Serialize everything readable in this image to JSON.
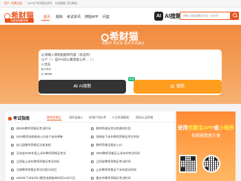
{
  "topbar": {
    "login": "用户 / 免费注册",
    "notice": "2023년 考试报名资讯",
    "link1": "在线客服",
    "link2": "官方微信"
  },
  "header": {
    "logo_text": "希财猫",
    "logo_sub": "优题宝刷题神器",
    "nav": [
      "首页",
      "题库",
      "考试资讯",
      "搜题APP",
      "问鉴"
    ],
    "ai_label": "AI搜题",
    "search_placeholder": "请输入或粘贴题目内容（含选项）"
  },
  "hero": {
    "brand": "希财猫",
    "slogan": "找题目 找答案  助考考试通过",
    "question_lines": [
      "Q:请输入或粘贴题目内容（含选项）",
      "以下（  ）是IPO前公募基金公开...（ ）",
      "A.优先",
      "B.CPU",
      "C.ROM"
    ],
    "ai_button": "AI搜题",
    "new_tag": "NEW",
    "search_button": "搜题"
  },
  "panel": {
    "title": "考试指南",
    "tabs": [
      "教师资格证",
      "消防设施人",
      "房地产估价师",
      "人力资源管理",
      "保险从业资格"
    ],
    "left_items": [
      "湖州市教师资格证考试时间",
      "2025教资成绩查询入口各个省市更新",
      "幼儿园教师资格证注册流程",
      "河北省2025年度上半年教师资格证考试",
      "江西省上半年教师资格证考试时间",
      "河南教师资格证考试内容与科目",
      "2025年下半年四川教资成绩查询时间(11月7日)"
    ],
    "right_items": [
      "教师资格证考试的规则作用",
      "湖南省下半年教师资格证考试时间",
      "教师资格证报名入口",
      "2025教师资格证上半年的考试时间",
      "江西省教师资格证考试时间",
      "山东教师资格证下半年面试时间",
      "重庆市教师资格证考试时间"
    ]
  },
  "promo": {
    "title_prefix": "使用",
    "title_highlight": "优题宝APP",
    "title_mid": "或",
    "title_highlight2": "小程序",
    "subtitle": "拍照搜题更方便"
  }
}
